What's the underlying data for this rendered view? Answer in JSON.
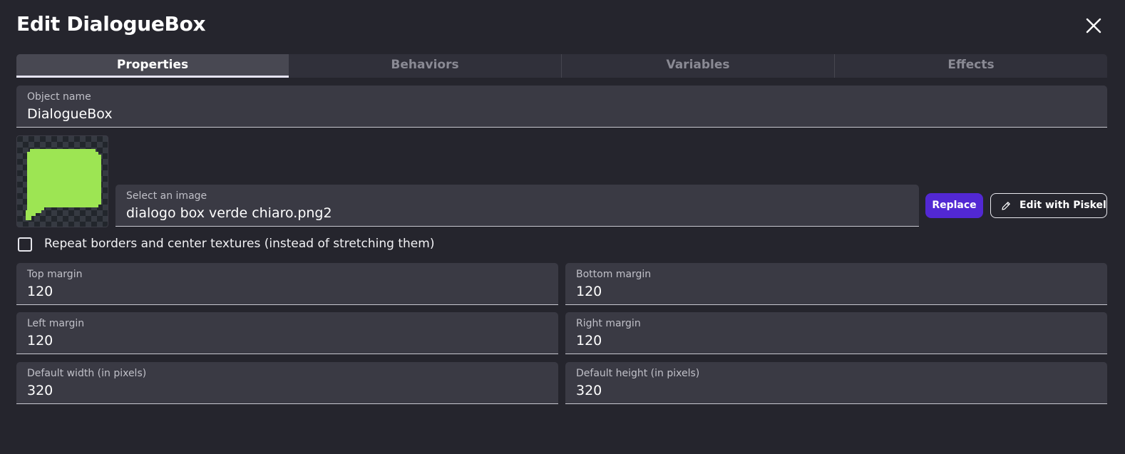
{
  "dialog": {
    "title": "Edit DialogueBox"
  },
  "tabs": [
    {
      "label": "Properties",
      "active": true
    },
    {
      "label": "Behaviors",
      "active": false
    },
    {
      "label": "Variables",
      "active": false
    },
    {
      "label": "Effects",
      "active": false
    }
  ],
  "object_name": {
    "label": "Object name",
    "value": "DialogueBox"
  },
  "image": {
    "label": "Select an image",
    "value": "dialogo box verde chiaro.png2",
    "preview_color": "#9de553"
  },
  "buttons": {
    "replace": "Replace",
    "edit_piskel": "Edit with Piskel"
  },
  "repeat_checkbox": {
    "label": "Repeat borders and center textures (instead of stretching them)",
    "checked": false
  },
  "margins": {
    "top": {
      "label": "Top margin",
      "value": "120"
    },
    "bottom": {
      "label": "Bottom margin",
      "value": "120"
    },
    "left": {
      "label": "Left margin",
      "value": "120"
    },
    "right": {
      "label": "Right margin",
      "value": "120"
    }
  },
  "size": {
    "width": {
      "label": "Default width (in pixels)",
      "value": "320"
    },
    "height": {
      "label": "Default height (in pixels)",
      "value": "320"
    }
  },
  "colors": {
    "background": "#25252d",
    "field": "#3a3a44",
    "accent": "#5228d3"
  }
}
